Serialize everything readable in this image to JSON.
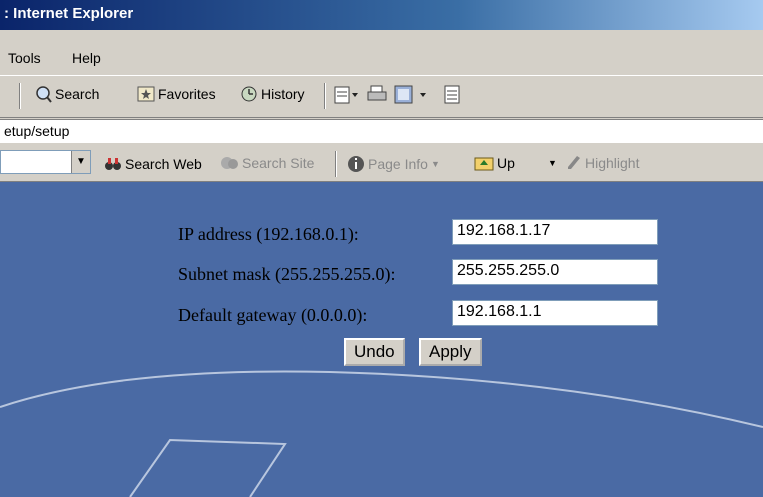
{
  "window": {
    "title": ": Internet Explorer"
  },
  "menu": {
    "tools": "Tools",
    "help": "Help"
  },
  "toolbar": {
    "search": "Search",
    "favorites": "Favorites",
    "history": "History"
  },
  "address": {
    "value": "etup/setup"
  },
  "links": {
    "search_web": "Search Web",
    "search_site": "Search Site",
    "page_info": "Page Info",
    "up": "Up",
    "highlight": "Highlight"
  },
  "form": {
    "ip_label": "IP address (192.168.0.1):",
    "ip_value": "192.168.1.17",
    "mask_label": "Subnet mask (255.255.255.0):",
    "mask_value": "255.255.255.0",
    "gw_label": "Default gateway (0.0.0.0):",
    "gw_value": "192.168.1.1",
    "undo": "Undo",
    "apply": "Apply"
  },
  "colors": {
    "content_bg": "#4a6aa4",
    "title_bar": "#0a246a",
    "chrome": "#d4d0c8"
  }
}
